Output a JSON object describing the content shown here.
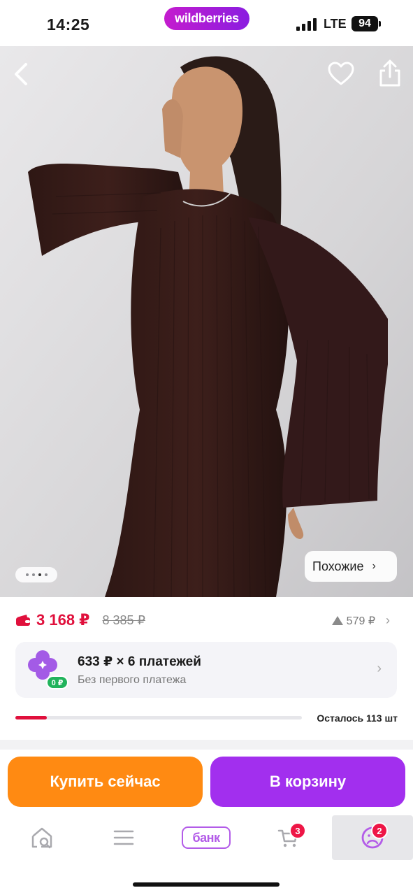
{
  "status_bar": {
    "time": "14:25",
    "network": "LTE",
    "battery": "94"
  },
  "brand": {
    "logo_text": "wildberries",
    "color": "#a41fd9"
  },
  "photo": {
    "description_icon": "product-photo",
    "gallery_current_index": 3,
    "gallery_count": 4,
    "similar_label": "Похожие"
  },
  "price": {
    "current": "3 168 ₽",
    "old": "8 385 ₽",
    "change": "579 ₽",
    "current_color": "#e0103c"
  },
  "installment": {
    "title": "633 ₽ × 6 платежей",
    "subtitle": "Без первого платежа",
    "badge": "0 ₽"
  },
  "stock": {
    "text": "Осталось 113 шт",
    "level": 0.11
  },
  "actions": {
    "buy_now": "Купить сейчас",
    "add_to_cart": "В корзину",
    "buy_color": "#ff8a12",
    "cart_color": "#a22fee"
  },
  "tab_bar": {
    "items": [
      {
        "name": "home",
        "icon": "home-search-icon"
      },
      {
        "name": "catalog",
        "icon": "menu-icon"
      },
      {
        "name": "bank",
        "label": "банк"
      },
      {
        "name": "cart",
        "icon": "cart-icon",
        "badge": "3"
      },
      {
        "name": "profile",
        "icon": "profile-icon",
        "badge": "2"
      }
    ]
  }
}
